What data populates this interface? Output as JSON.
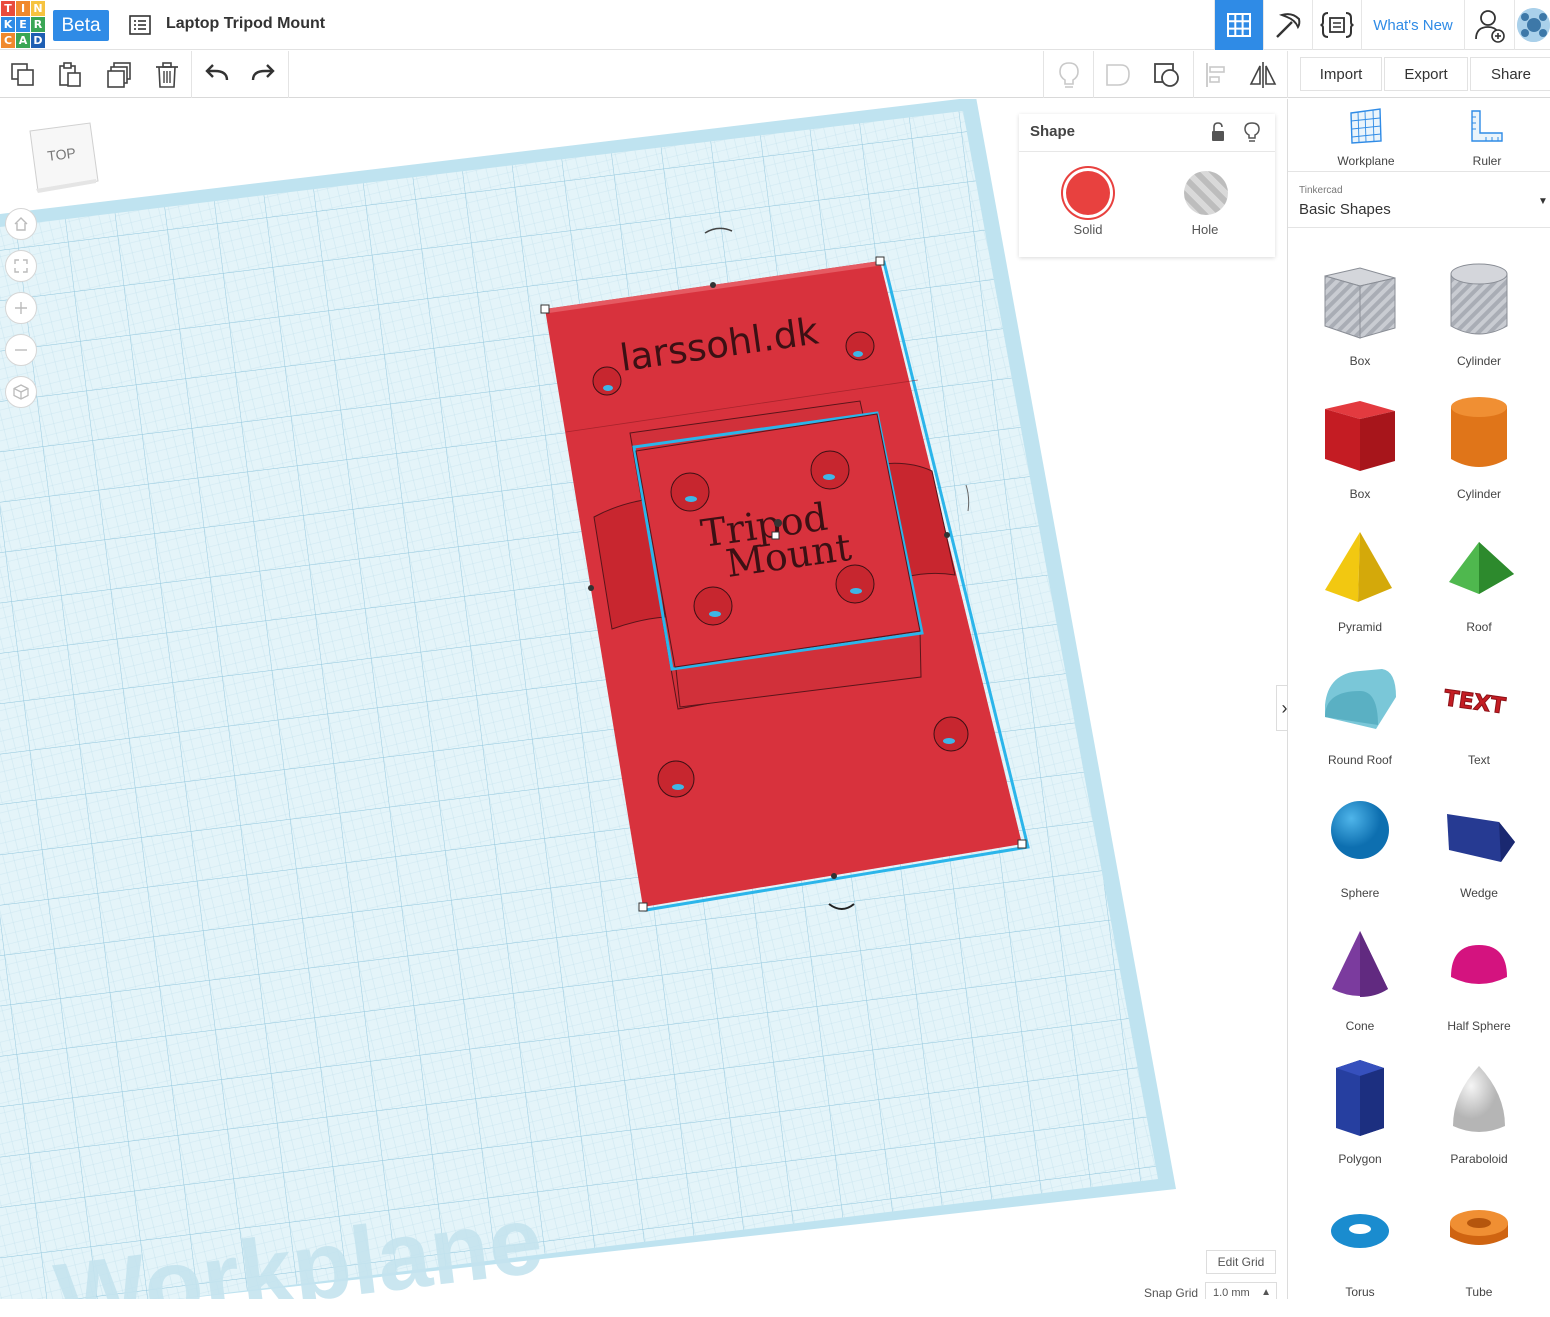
{
  "app": {
    "logo_letters": [
      "T",
      "I",
      "N",
      "K",
      "E",
      "R",
      "C",
      "A",
      "D"
    ],
    "logo_colors": [
      "#e94b3c",
      "#f0892d",
      "#f6c340",
      "#2f8be6",
      "#2f8be6",
      "#3aa655",
      "#f0892d",
      "#3aa655",
      "#1f5fb3"
    ],
    "beta_label": "Beta",
    "design_title": "Laptop Tripod Mount",
    "whats_new": "What's New"
  },
  "topbar_icons": [
    "grid-view-icon",
    "pickaxe-icon",
    "code-blocks-icon",
    "add-user-icon",
    "user-avatar-icon"
  ],
  "toolbar": {
    "left_icons": [
      "copy-icon",
      "paste-icon",
      "duplicate-icon",
      "delete-icon",
      "undo-icon",
      "redo-icon"
    ],
    "right_icons": [
      "lightbulb-icon",
      "group-icon",
      "ungroup-icon",
      "align-icon",
      "mirror-icon"
    ],
    "import_label": "Import",
    "export_label": "Export",
    "share_label": "Share"
  },
  "viewcube": {
    "face_label": "TOP"
  },
  "nav_buttons": [
    "home-view-icon",
    "fit-all-icon",
    "zoom-in-icon",
    "zoom-out-icon",
    "perspective-icon"
  ],
  "workplane": {
    "watermark": "Workplane",
    "model_texts": {
      "website": "larssohl.dk",
      "line1": "Tripod",
      "line2": "Mount"
    }
  },
  "inspector": {
    "title": "Shape",
    "solid_label": "Solid",
    "hole_label": "Hole",
    "solid_color": "#e8413f"
  },
  "grid_controls": {
    "edit_grid_label": "Edit Grid",
    "snap_grid_label": "Snap Grid",
    "snap_grid_value": "1.0 mm"
  },
  "right_panel": {
    "tools": [
      {
        "label": "Workplane",
        "icon": "workplane-icon"
      },
      {
        "label": "Ruler",
        "icon": "ruler-icon"
      }
    ],
    "category_source": "Tinkercad",
    "category_name": "Basic Shapes",
    "shapes": [
      {
        "label": "Box",
        "icon": "box-hole-icon",
        "color": "#b8bcc4"
      },
      {
        "label": "Cylinder",
        "icon": "cylinder-hole-icon",
        "color": "#b8bcc4"
      },
      {
        "label": "Box",
        "icon": "box-icon",
        "color": "#d31f26"
      },
      {
        "label": "Cylinder",
        "icon": "cylinder-icon",
        "color": "#e8781e"
      },
      {
        "label": "Pyramid",
        "icon": "pyramid-icon",
        "color": "#f2c811"
      },
      {
        "label": "Roof",
        "icon": "roof-icon",
        "color": "#3ea63d"
      },
      {
        "label": "Round Roof",
        "icon": "round-roof-icon",
        "color": "#6bbed0"
      },
      {
        "label": "Text",
        "icon": "text-shape-icon",
        "color": "#d31f26"
      },
      {
        "label": "Sphere",
        "icon": "sphere-icon",
        "color": "#1b8ed6"
      },
      {
        "label": "Wedge",
        "icon": "wedge-icon",
        "color": "#23358a"
      },
      {
        "label": "Cone",
        "icon": "cone-icon",
        "color": "#7b3b9e"
      },
      {
        "label": "Half Sphere",
        "icon": "half-sphere-icon",
        "color": "#d4137f"
      },
      {
        "label": "Polygon",
        "icon": "polygon-icon",
        "color": "#243c9c"
      },
      {
        "label": "Paraboloid",
        "icon": "paraboloid-icon",
        "color": "#d9d9d9"
      },
      {
        "label": "Torus",
        "icon": "torus-icon",
        "color": "#1a8ccf"
      },
      {
        "label": "Tube",
        "icon": "tube-icon",
        "color": "#e8781e"
      }
    ]
  }
}
